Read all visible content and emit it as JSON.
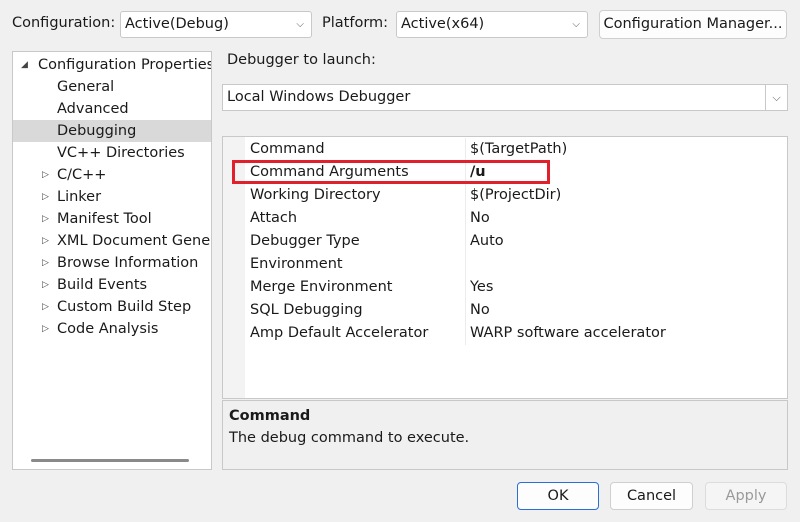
{
  "toolbar": {
    "configuration_label": "Configuration:",
    "configuration_value": "Active(Debug)",
    "platform_label": "Platform:",
    "platform_value": "Active(x64)",
    "config_manager_button": "Configuration Manager..."
  },
  "tree": {
    "root": "Configuration Properties",
    "items": [
      {
        "label": "General",
        "expandable": false
      },
      {
        "label": "Advanced",
        "expandable": false
      },
      {
        "label": "Debugging",
        "expandable": false,
        "selected": true
      },
      {
        "label": "VC++ Directories",
        "expandable": false
      },
      {
        "label": "C/C++",
        "expandable": true
      },
      {
        "label": "Linker",
        "expandable": true
      },
      {
        "label": "Manifest Tool",
        "expandable": true
      },
      {
        "label": "XML Document Genera",
        "expandable": true
      },
      {
        "label": "Browse Information",
        "expandable": true
      },
      {
        "label": "Build Events",
        "expandable": true
      },
      {
        "label": "Custom Build Step",
        "expandable": true
      },
      {
        "label": "Code Analysis",
        "expandable": true
      }
    ]
  },
  "debugger": {
    "label": "Debugger to launch:",
    "value": "Local Windows Debugger"
  },
  "properties": [
    {
      "name": "Command",
      "value": "$(TargetPath)"
    },
    {
      "name": "Command Arguments",
      "value": "/u",
      "bold": true,
      "highlighted": true
    },
    {
      "name": "Working Directory",
      "value": "$(ProjectDir)"
    },
    {
      "name": "Attach",
      "value": "No"
    },
    {
      "name": "Debugger Type",
      "value": "Auto"
    },
    {
      "name": "Environment",
      "value": ""
    },
    {
      "name": "Merge Environment",
      "value": "Yes"
    },
    {
      "name": "SQL Debugging",
      "value": "No"
    },
    {
      "name": "Amp Default Accelerator",
      "value": "WARP software accelerator"
    }
  ],
  "description": {
    "title": "Command",
    "text": "The debug command to execute."
  },
  "buttons": {
    "ok": "OK",
    "cancel": "Cancel",
    "apply": "Apply"
  },
  "colors": {
    "highlight_border": "#e0202a",
    "selected_bg": "#d9d9d9",
    "ok_border": "#2a6fd6"
  }
}
